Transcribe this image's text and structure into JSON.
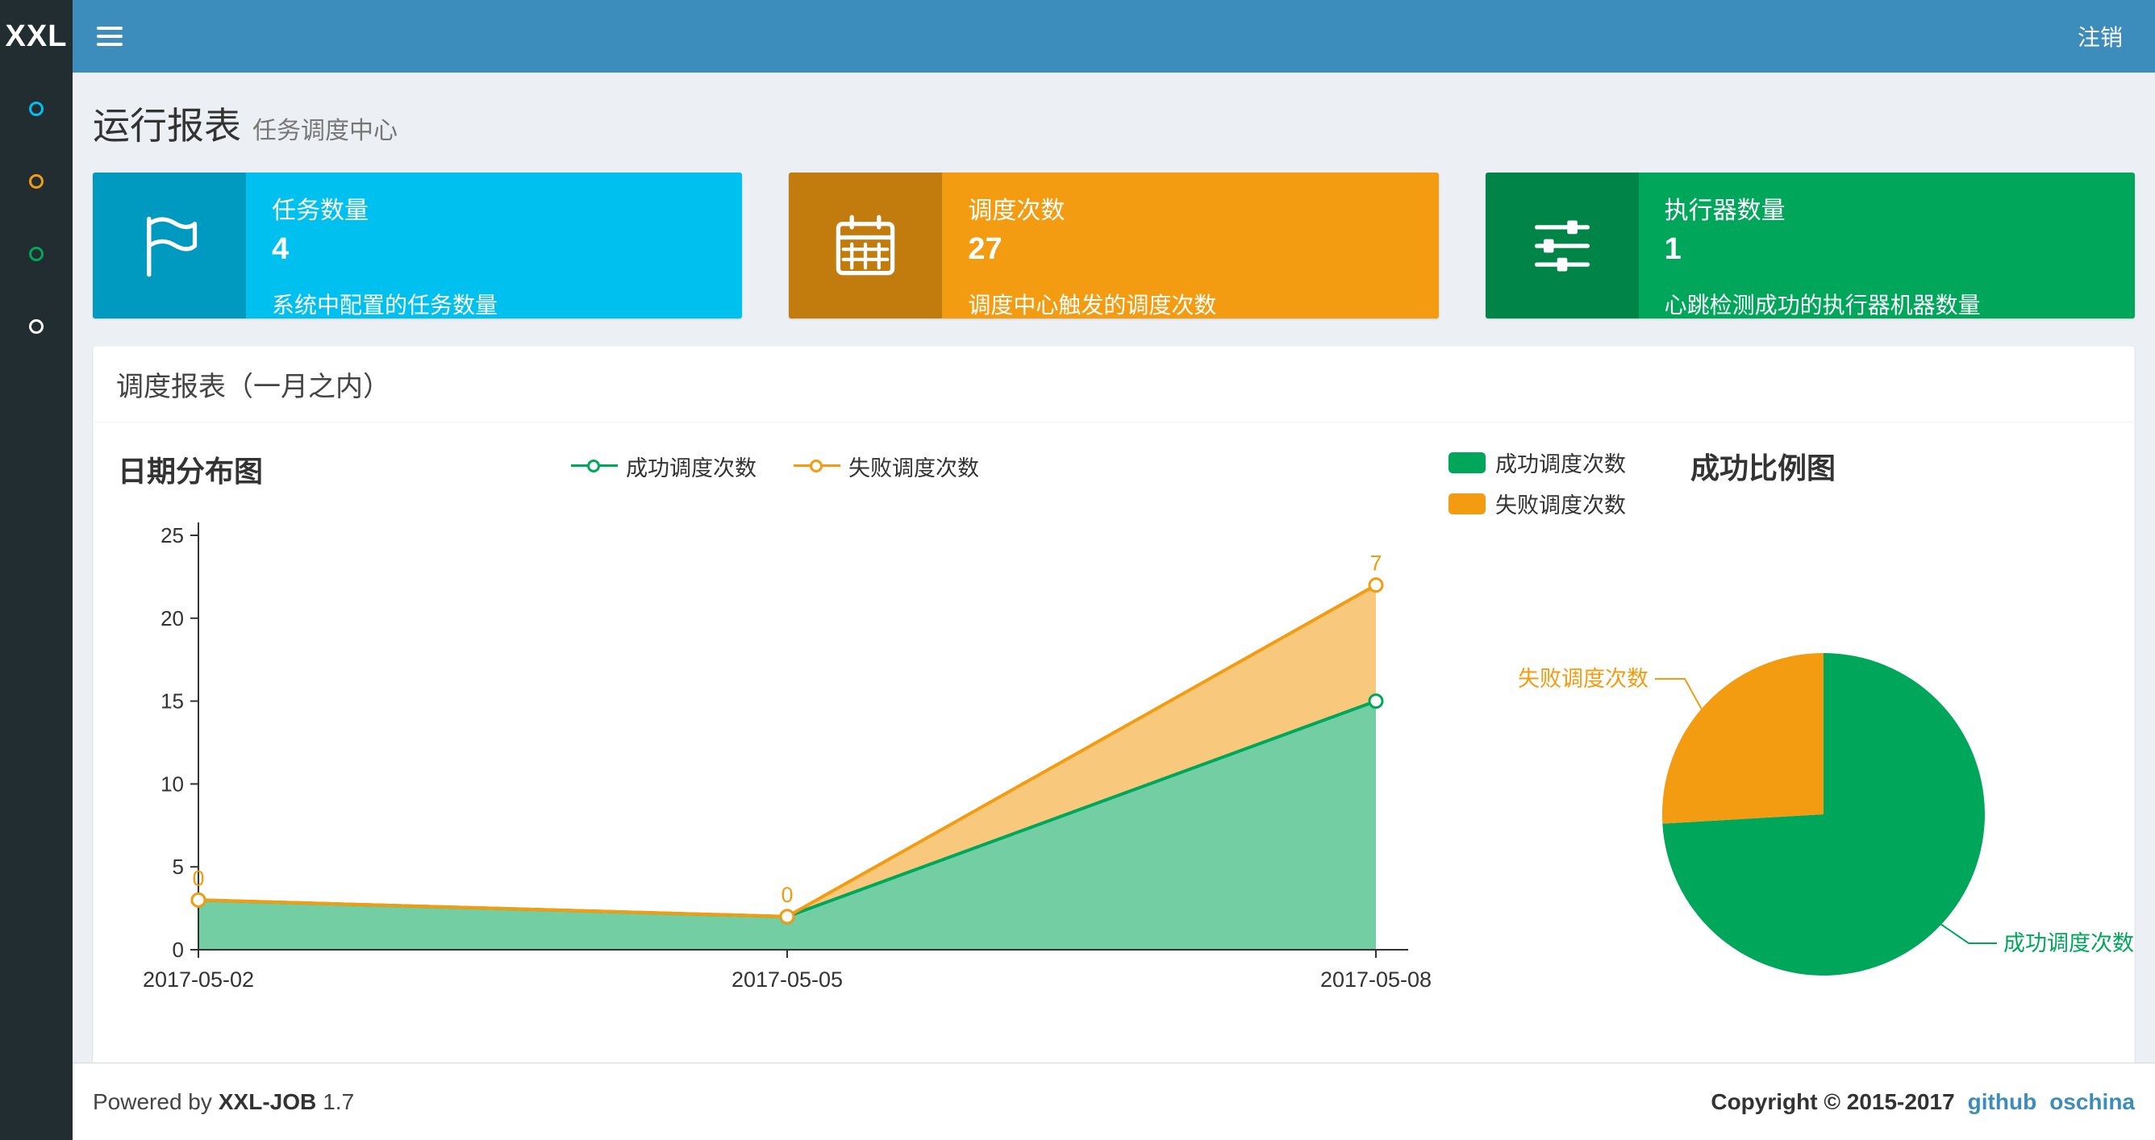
{
  "app": {
    "logo_text": "XXL",
    "logout_label": "注销"
  },
  "sidebar": {
    "items": [
      {
        "name": "menu-report",
        "color": "#00c0ef"
      },
      {
        "name": "menu-jobs",
        "color": "#f39c12"
      },
      {
        "name": "menu-log",
        "color": "#00a65a"
      },
      {
        "name": "menu-executor",
        "color": "#ffffff"
      }
    ]
  },
  "page": {
    "title": "运行报表",
    "subtitle": "任务调度中心"
  },
  "info_boxes": [
    {
      "label": "任务数量",
      "value": "4",
      "desc": "系统中配置的任务数量",
      "color": "#00c0ef",
      "icon": "flag-icon"
    },
    {
      "label": "调度次数",
      "value": "27",
      "desc": "调度中心触发的调度次数",
      "color": "#f39c12",
      "icon": "calendar-icon"
    },
    {
      "label": "执行器数量",
      "value": "1",
      "desc": "心跳检测成功的执行器机器数量",
      "color": "#00a65a",
      "icon": "sliders-icon"
    }
  ],
  "panel": {
    "title": "调度报表（一月之内）"
  },
  "chart_data": [
    {
      "type": "area",
      "title": "日期分布图",
      "x": [
        "2017-05-02",
        "2017-05-05",
        "2017-05-08"
      ],
      "series": [
        {
          "name": "成功调度次数",
          "values": [
            3,
            2,
            15
          ],
          "color": "#00a65a"
        },
        {
          "name": "失败调度次数",
          "values": [
            0,
            0,
            7
          ],
          "color": "#f39c12"
        }
      ],
      "stacked": true,
      "point_labels": {
        "series": "失败调度次数",
        "values": [
          0,
          0,
          7
        ]
      },
      "ylim": [
        0,
        25
      ],
      "yticks": [
        0,
        5,
        10,
        15,
        20,
        25
      ],
      "legend_position": "top-center",
      "grid": false
    },
    {
      "type": "pie",
      "title": "成功比例图",
      "slices": [
        {
          "name": "成功调度次数",
          "value": 20,
          "color": "#00a65a"
        },
        {
          "name": "失败调度次数",
          "value": 7,
          "color": "#f39c12"
        }
      ],
      "legend_position": "top-left"
    }
  ],
  "footer": {
    "powered_prefix": "Powered by",
    "brand": "XXL-JOB",
    "version": "1.7",
    "copyright": "Copyright © 2015-2017",
    "links": [
      "github",
      "oschina"
    ],
    "link_color": "#3c8dbc"
  }
}
